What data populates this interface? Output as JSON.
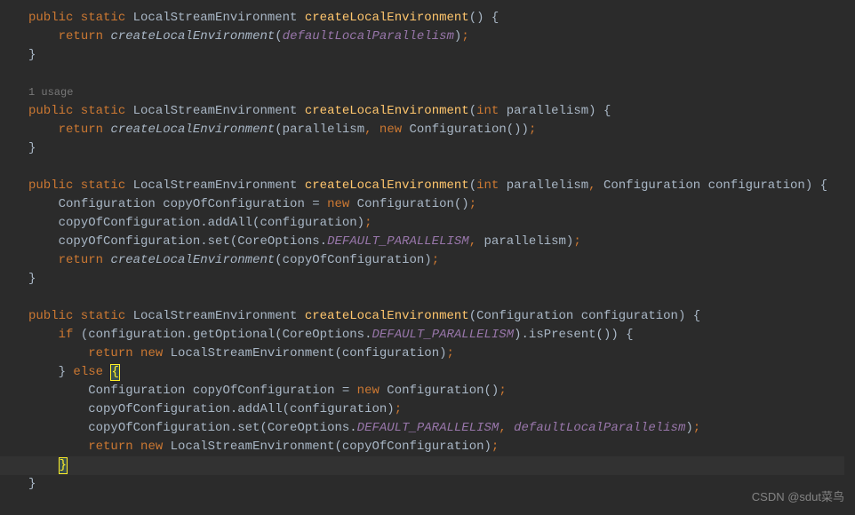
{
  "method1": {
    "modifiers": "public static",
    "returnType": "LocalStreamEnvironment",
    "name": "createLocalEnvironment",
    "params_open": "()",
    "brace_open": " {",
    "return_kw": "return",
    "call": "createLocalEnvironment",
    "arg": "defaultLocalParallelism",
    "close": ");",
    "end_brace": "}"
  },
  "usage_hint": "1 usage",
  "method2": {
    "modifiers": "public static",
    "returnType": "LocalStreamEnvironment",
    "name": "createLocalEnvironment",
    "p_open": "(",
    "p_type": "int",
    "p_name": " parallelism",
    "p_close": ")",
    "brace_open": " {",
    "return_kw": "return",
    "call": "createLocalEnvironment",
    "arg1": "(parallelism",
    "comma": ",",
    "new_kw": " new",
    "ctor": " Configuration())",
    "semi": ";",
    "end_brace": "}"
  },
  "method3": {
    "modifiers": "public static",
    "returnType": "LocalStreamEnvironment",
    "name": "createLocalEnvironment",
    "p_open": "(",
    "p1_type": "int",
    "p1_name": " parallelism",
    "c1": ",",
    "p2": " Configuration configuration)",
    "brace_open": " {",
    "l1_a": "Configuration copyOfConfiguration = ",
    "l1_new": "new",
    "l1_b": " Configuration()",
    "l1_semi": ";",
    "l2_a": "copyOfConfiguration.addAll(configuration)",
    "l2_semi": ";",
    "l3_a": "copyOfConfiguration.set(CoreOptions.",
    "l3_const": "DEFAULT_PARALLELISM",
    "l3_c": ",",
    "l3_b": " parallelism)",
    "l3_semi": ";",
    "return_kw": "return",
    "call": "createLocalEnvironment",
    "ret_arg": "(copyOfConfiguration)",
    "ret_semi": ";",
    "end_brace": "}"
  },
  "method4": {
    "modifiers": "public static",
    "returnType": "LocalStreamEnvironment",
    "name": "createLocalEnvironment",
    "p": "(Configuration configuration)",
    "brace_open": " {",
    "if_kw": "if",
    "if_cond_a": " (configuration.getOptional(CoreOptions.",
    "if_const": "DEFAULT_PARALLELISM",
    "if_cond_b": ").isPresent()) {",
    "ret1_kw": "return",
    "ret1_new": " new",
    "ret1_rest": " LocalStreamEnvironment(configuration)",
    "ret1_semi": ";",
    "else_close": "}",
    "else_kw": " else",
    "else_open": " ",
    "else_brace": "{",
    "l1_a": "Configuration copyOfConfiguration = ",
    "l1_new": "new",
    "l1_b": " Configuration()",
    "l1_semi": ";",
    "l2_a": "copyOfConfiguration.addAll(configuration)",
    "l2_semi": ";",
    "l3_a": "copyOfConfiguration.set(CoreOptions.",
    "l3_const": "DEFAULT_PARALLELISM",
    "l3_c": ",",
    "l3_arg": " defaultLocalParallelism",
    "l3_b": ")",
    "l3_semi": ";",
    "ret2_kw": "return",
    "ret2_new": " new",
    "ret2_rest": " LocalStreamEnvironment(copyOfConfiguration)",
    "ret2_semi": ";",
    "inner_close": "}",
    "end_brace": "}"
  },
  "watermark": "CSDN @sdut菜鸟"
}
